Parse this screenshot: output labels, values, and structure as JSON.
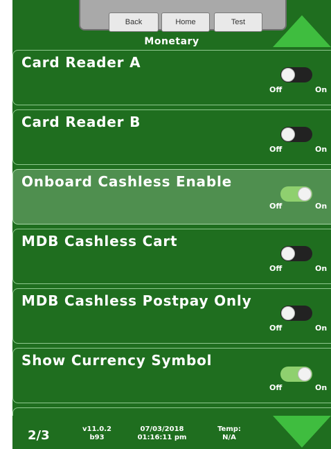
{
  "nav": {
    "back_label": "Back",
    "home_label": "Home",
    "test_label": "Test",
    "title": "Monetary"
  },
  "switch_labels": {
    "off": "Off",
    "on": "On"
  },
  "rows": [
    {
      "label": "Card Reader A",
      "state": "off"
    },
    {
      "label": "Card Reader B",
      "state": "off"
    },
    {
      "label": "Onboard Cashless Enable",
      "state": "on",
      "highlighted": true
    },
    {
      "label": "MDB Cashless Cart",
      "state": "off"
    },
    {
      "label": "MDB Cashless Postpay Only",
      "state": "off"
    },
    {
      "label": "Show Currency Symbol",
      "state": "on"
    }
  ],
  "footer": {
    "page": "2/3",
    "version": "v11.0.2",
    "build": "b93",
    "date": "07/03/2018",
    "time": "01:16:11 pm",
    "temp_label": "Temp:",
    "temp_value": "N/A"
  },
  "colors": {
    "background": "#1f6e1f",
    "arrow": "#3fbd3f",
    "switch_on": "#8fd06f",
    "switch_off": "#222222"
  },
  "icons": {
    "scroll_up": "triangle-up-icon",
    "scroll_down": "triangle-down-icon"
  }
}
